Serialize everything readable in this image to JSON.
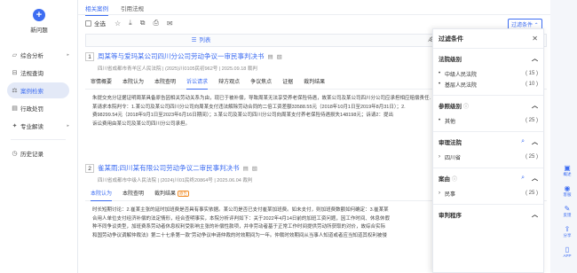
{
  "sidebar": {
    "new_label": "新问题",
    "items": [
      {
        "label": "综合分析",
        "icon": "▱",
        "arrow": "▸"
      },
      {
        "label": "法规查询",
        "icon": "⊟",
        "arrow": ""
      },
      {
        "label": "案例检索",
        "icon": "⚖",
        "arrow": ""
      },
      {
        "label": "行政处罚",
        "icon": "▤",
        "arrow": ""
      },
      {
        "label": "专业解读",
        "icon": "✦",
        "arrow": "▸"
      }
    ],
    "history_label": "历史记录"
  },
  "tabs": [
    "相关案例",
    "引用法规"
  ],
  "toolbar": {
    "select_all": "全选",
    "filter": "过滤条件 ⌃"
  },
  "views": [
    "列表",
    "Ǽ"
  ],
  "cases": [
    {
      "num": "1",
      "title": "周某等与爱玛某公司四川分公司劳动争议一审民事判决书",
      "meta": "四川省成都市青羊区人民法院  |  (2025)川0105民初962号  |  2025.09.18 裁判",
      "subtabs": [
        "审情概要",
        "本院认为",
        "本院查明",
        "诉讼请求",
        "辩方观点",
        "争议焦点",
        "证据",
        "裁判结果"
      ],
      "active_tab": 3,
      "body": [
        "朱提交充分证据证明周某具备原告因相关劳动关系为由，现已于被补偿，导致周某无法享受养老保险待遇，故某公司及某公司四川分公司应承担相应赔偿责任……",
        "某请求本院判令：1.某公司及某公司四川分公司向周某支付违法解除劳动合同的二倍工资差额33588.55元（2018年10月1日至2019年8月31日）；2.",
        "费98299.54元（2018年9月1日至2023年6月16日期间）；3.某公司及某公司四川分公司向周某支付养老保险待遇损失148198元；诉请2：提出",
        "诉讼费用由某公司及某公司四川分公司承担。"
      ]
    },
    {
      "num": "2",
      "title": "雀某雨;四川某有限公司劳动争议二审民事判决书",
      "meta": "四川省成都市中级人民法院  |  (2024)川01民终20864号  |  2025.06.04 裁判",
      "subtabs": [
        "本院认为",
        "本院查明",
        "裁判结果"
      ],
      "active_tab": 0,
      "badge": "原告",
      "body": [
        "时长短期讨论：2.崔某主张的延时加班费是否具有事实依据。某公司是否已支付崔某加班费。如未支付，则加班费数额如何确定：3.崔某某",
        "合用人单位支付经济补偿的法定情形，经合查明事实，本院分析评判如下：关于2022年4月14日前的加班工资问题，因工作时间、休息休假",
        "种不同争议类型，加班费系劳动者休息权利受影响主张的补偿性款项，并非劳动者基于正常工作时间提供劳动所获取的对价，故综合实际",
        "和国劳动争议调解仲裁法》第二十七条第一款“劳动争议申请仲裁的时效期间为一年。仲裁时效期间从当事人知道或者应当知道其权利被侵"
      ]
    }
  ],
  "panel": {
    "title": "过滤条件",
    "sections": [
      {
        "name": "法院级别",
        "info": false,
        "search": false,
        "options": [
          {
            "label": "中级人民法院",
            "count": "( 15 )",
            "bullet": "•"
          },
          {
            "label": "基层人民法院",
            "count": "( 10 )",
            "bullet": "•"
          }
        ]
      },
      {
        "name": "参照级别",
        "info": true,
        "search": false,
        "options": [
          {
            "label": "其他",
            "count": "( 25 )",
            "bullet": "•"
          }
        ]
      },
      {
        "name": "审理法院",
        "info": false,
        "search": true,
        "options": [
          {
            "label": "四川省",
            "count": "( 25 )",
            "bullet": "›"
          }
        ]
      },
      {
        "name": "案由",
        "info": true,
        "search": true,
        "options": [
          {
            "label": "民事",
            "count": "( 25 )",
            "bullet": "›"
          }
        ]
      },
      {
        "name": "审判程序",
        "info": false,
        "search": false,
        "options": []
      }
    ]
  },
  "rail": [
    {
      "label": "概述",
      "icon": "▣"
    },
    {
      "label": "客服",
      "icon": "◉"
    },
    {
      "label": "反馈",
      "icon": "✎"
    },
    {
      "label": "分享",
      "icon": "⇪"
    },
    {
      "label": "APP",
      "icon": "▯"
    }
  ]
}
